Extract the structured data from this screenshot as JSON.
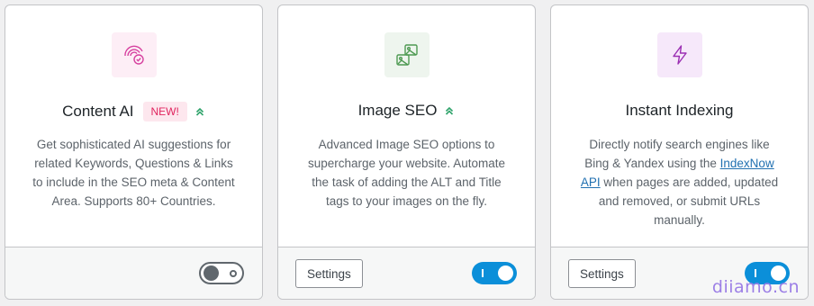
{
  "modules": [
    {
      "title": "Content AI",
      "badge": "NEW!",
      "icon": "content-ai-icon",
      "accent": "#d6409f",
      "icon_bg": "#fdeef6",
      "description": "Get sophisticated AI suggestions for related Keywords, Questions & Links to include in the SEO meta & Content Area. Supports 80+ Countries.",
      "toggle_on": false
    },
    {
      "title": "Image SEO",
      "icon": "images-icon",
      "accent": "#4e9a52",
      "icon_bg": "#eef5ee",
      "description": "Advanced Image SEO options to supercharge your website. Automate the task of adding the ALT and Title tags to your images on the fly.",
      "settings_label": "Settings",
      "toggle_on": true
    },
    {
      "title": "Instant Indexing",
      "icon": "lightning-icon",
      "accent": "#9b2fb3",
      "icon_bg": "#f6e8fa",
      "description_before": "Directly notify search engines like Bing & Yandex using the ",
      "description_link": "IndexNow API",
      "description_after": " when pages are added, updated and removed, or submit URLs manually.",
      "settings_label": "Settings",
      "toggle_on": true
    }
  ],
  "watermark": "diiamo.cn",
  "colors": {
    "toggle_on": "#0b8fd9",
    "badge_text": "#e0245e",
    "badge_bg": "#fde7ee",
    "pro_chevron": "#2fa36b"
  }
}
